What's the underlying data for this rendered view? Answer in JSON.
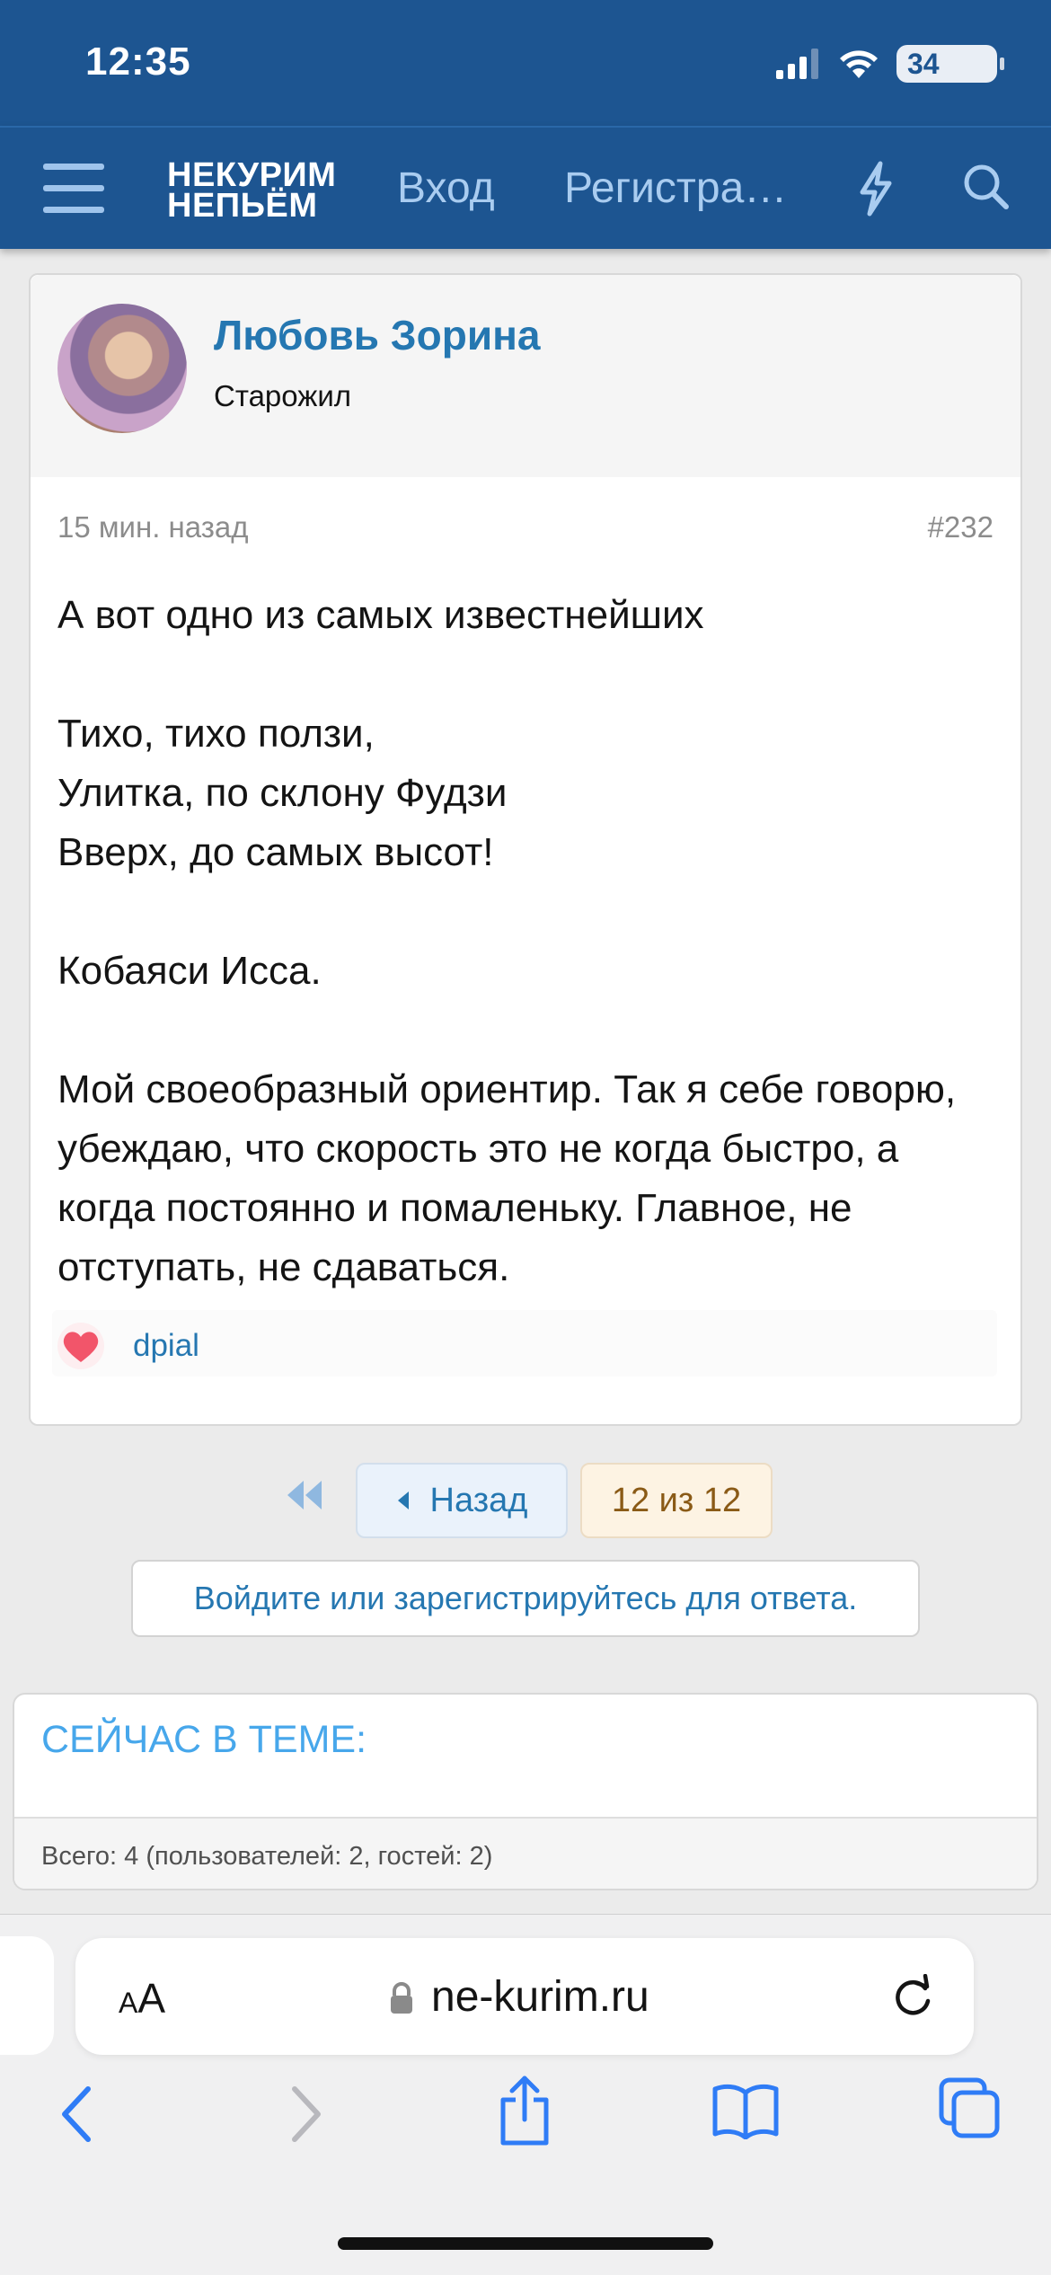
{
  "status_bar": {
    "time": "12:35",
    "battery": "34"
  },
  "header": {
    "logo_line1": "НЕКУРИМ",
    "logo_line2": "НЕПЬЁМ",
    "login": "Вход",
    "register": "Регистрация"
  },
  "post": {
    "author": "Любовь Зорина",
    "author_title": "Старожил",
    "time_ago": "15 мин. назад",
    "number": "#232",
    "paragraphs": [
      "А вот одно из самых известнейших",
      "Тихо, тихо ползи,\nУлитка, по склону Фудзи\nВверх, до самых высот!",
      "Кобаяси Исса.",
      "Мой своеобразный ориентир. Так я себе говорю, убеждаю, что скорость это не когда быстро, а когда постоянно и помаленьку. Главное, не отступать, не сдаваться."
    ],
    "reaction_user": "dpial"
  },
  "pagination": {
    "back_label": "Назад",
    "indicator": "12 из 12"
  },
  "reply_prompt": "Войдите или зарегистрируйтесь для ответа.",
  "now_in_topic": {
    "title": "СЕЙЧАС В ТЕМЕ:",
    "stats": "Всего: 4 (пользователей: 2, гостей: 2)"
  },
  "browser": {
    "text_size_small": "A",
    "text_size_large": "A",
    "url": "ne-kurim.ru"
  },
  "colors": {
    "header_bg": "#1d5591",
    "link": "#2577b1",
    "now_title": "#47a7eb",
    "browser_icon": "#2f7cf6"
  }
}
